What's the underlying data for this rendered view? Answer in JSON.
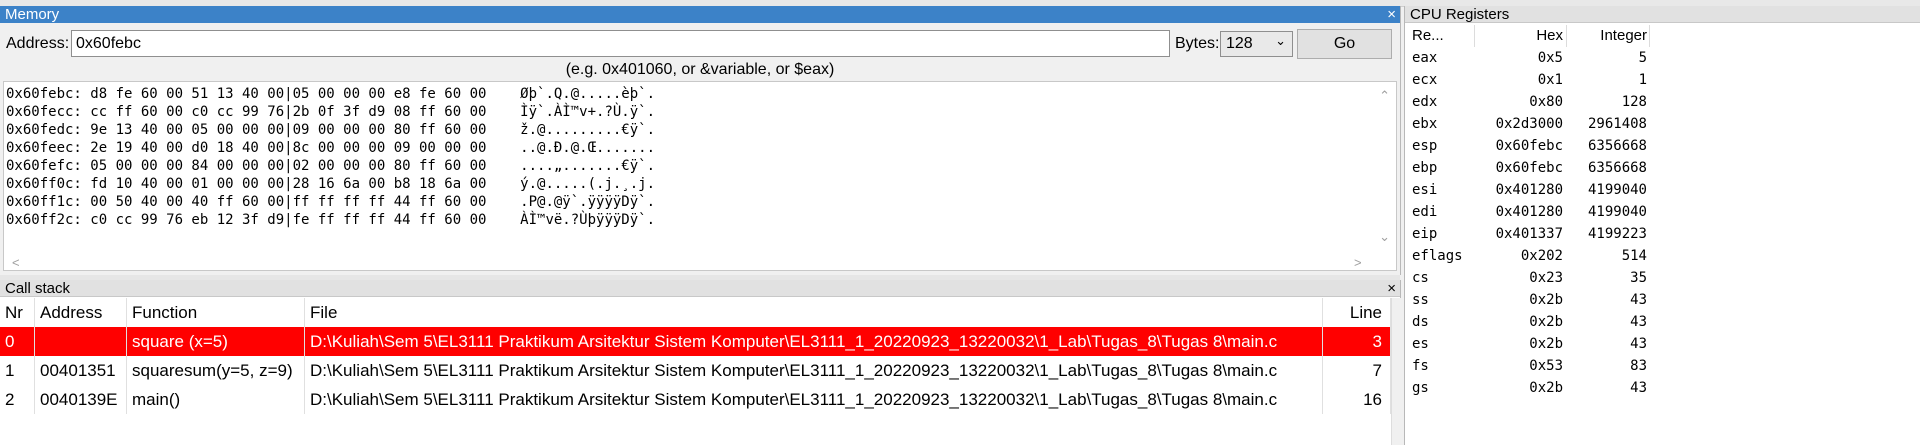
{
  "memory": {
    "title": "Memory",
    "close_glyph": "×",
    "address_label": "Address:",
    "address_value": "0x60febc",
    "bytes_label": "Bytes:",
    "bytes_value": "128",
    "go_label": "Go",
    "hint": "(e.g. 0x401060, or &variable, or $eax)",
    "dump": [
      "0x60febc: d8 fe 60 00 51 13 40 00|05 00 00 00 e8 fe 60 00    Øþ`.Q.@.....èþ`.",
      "0x60fecc: cc ff 60 00 c0 cc 99 76|2b 0f 3f d9 08 ff 60 00    Ìÿ`.ÀÌ™v+.?Ù.ÿ`.",
      "0x60fedc: 9e 13 40 00 05 00 00 00|09 00 00 00 80 ff 60 00    ž.@.........€ÿ`.",
      "0x60feec: 2e 19 40 00 d0 18 40 00|8c 00 00 00 09 00 00 00    ..@.Ð.@.Œ.......",
      "0x60fefc: 05 00 00 00 84 00 00 00|02 00 00 00 80 ff 60 00    ....„.......€ÿ`.",
      "0x60ff0c: fd 10 40 00 01 00 00 00|28 16 6a 00 b8 18 6a 00    ý.@.....(.j.¸.j.",
      "0x60ff1c: 00 50 40 00 40 ff 60 00|ff ff ff ff 44 ff 60 00    .P@.@ÿ`.ÿÿÿÿDÿ`.",
      "0x60ff2c: c0 cc 99 76 eb 12 3f d9|fe ff ff ff 44 ff 60 00    ÀÌ™vë.?ÙþÿÿÿDÿ`."
    ]
  },
  "callstack": {
    "title": "Call stack",
    "close_glyph": "×",
    "columns": {
      "nr": "Nr",
      "address": "Address",
      "function": "Function",
      "file": "File",
      "line": "Line"
    },
    "rows": [
      {
        "nr": "0",
        "address": "",
        "function": "square (x=5)",
        "file": "D:\\Kuliah\\Sem 5\\EL3111 Praktikum Arsitektur Sistem Komputer\\EL3111_1_20220923_13220032\\1_Lab\\Tugas_8\\Tugas 8\\main.c",
        "line": "3"
      },
      {
        "nr": "1",
        "address": "00401351",
        "function": "squaresum(y=5, z=9)",
        "file": "D:\\Kuliah\\Sem 5\\EL3111 Praktikum Arsitektur Sistem Komputer\\EL3111_1_20220923_13220032\\1_Lab\\Tugas_8\\Tugas 8\\main.c",
        "line": "7"
      },
      {
        "nr": "2",
        "address": "0040139E",
        "function": "main()",
        "file": "D:\\Kuliah\\Sem 5\\EL3111 Praktikum Arsitektur Sistem Komputer\\EL3111_1_20220923_13220032\\1_Lab\\Tugas_8\\Tugas 8\\main.c",
        "line": "16"
      }
    ],
    "selected_color": "#ff0000"
  },
  "cpu": {
    "title": "CPU Registers",
    "columns": {
      "name": "Re...",
      "hex": "Hex",
      "int": "Integer"
    },
    "registers": [
      {
        "name": "eax",
        "hex": "0x5",
        "int": "5"
      },
      {
        "name": "ecx",
        "hex": "0x1",
        "int": "1"
      },
      {
        "name": "edx",
        "hex": "0x80",
        "int": "128"
      },
      {
        "name": "ebx",
        "hex": "0x2d3000",
        "int": "2961408"
      },
      {
        "name": "esp",
        "hex": "0x60febc",
        "int": "6356668"
      },
      {
        "name": "ebp",
        "hex": "0x60febc",
        "int": "6356668"
      },
      {
        "name": "esi",
        "hex": "0x401280",
        "int": "4199040"
      },
      {
        "name": "edi",
        "hex": "0x401280",
        "int": "4199040"
      },
      {
        "name": "eip",
        "hex": "0x401337",
        "int": "4199223"
      },
      {
        "name": "eflags",
        "hex": "0x202",
        "int": "514"
      },
      {
        "name": "cs",
        "hex": "0x23",
        "int": "35"
      },
      {
        "name": "ss",
        "hex": "0x2b",
        "int": "43"
      },
      {
        "name": "ds",
        "hex": "0x2b",
        "int": "43"
      },
      {
        "name": "es",
        "hex": "0x2b",
        "int": "43"
      },
      {
        "name": "fs",
        "hex": "0x53",
        "int": "83"
      },
      {
        "name": "gs",
        "hex": "0x2b",
        "int": "43"
      }
    ]
  },
  "colors": {
    "memory_title_bg": "#3c82c8",
    "selected_row": "#ff0000"
  }
}
